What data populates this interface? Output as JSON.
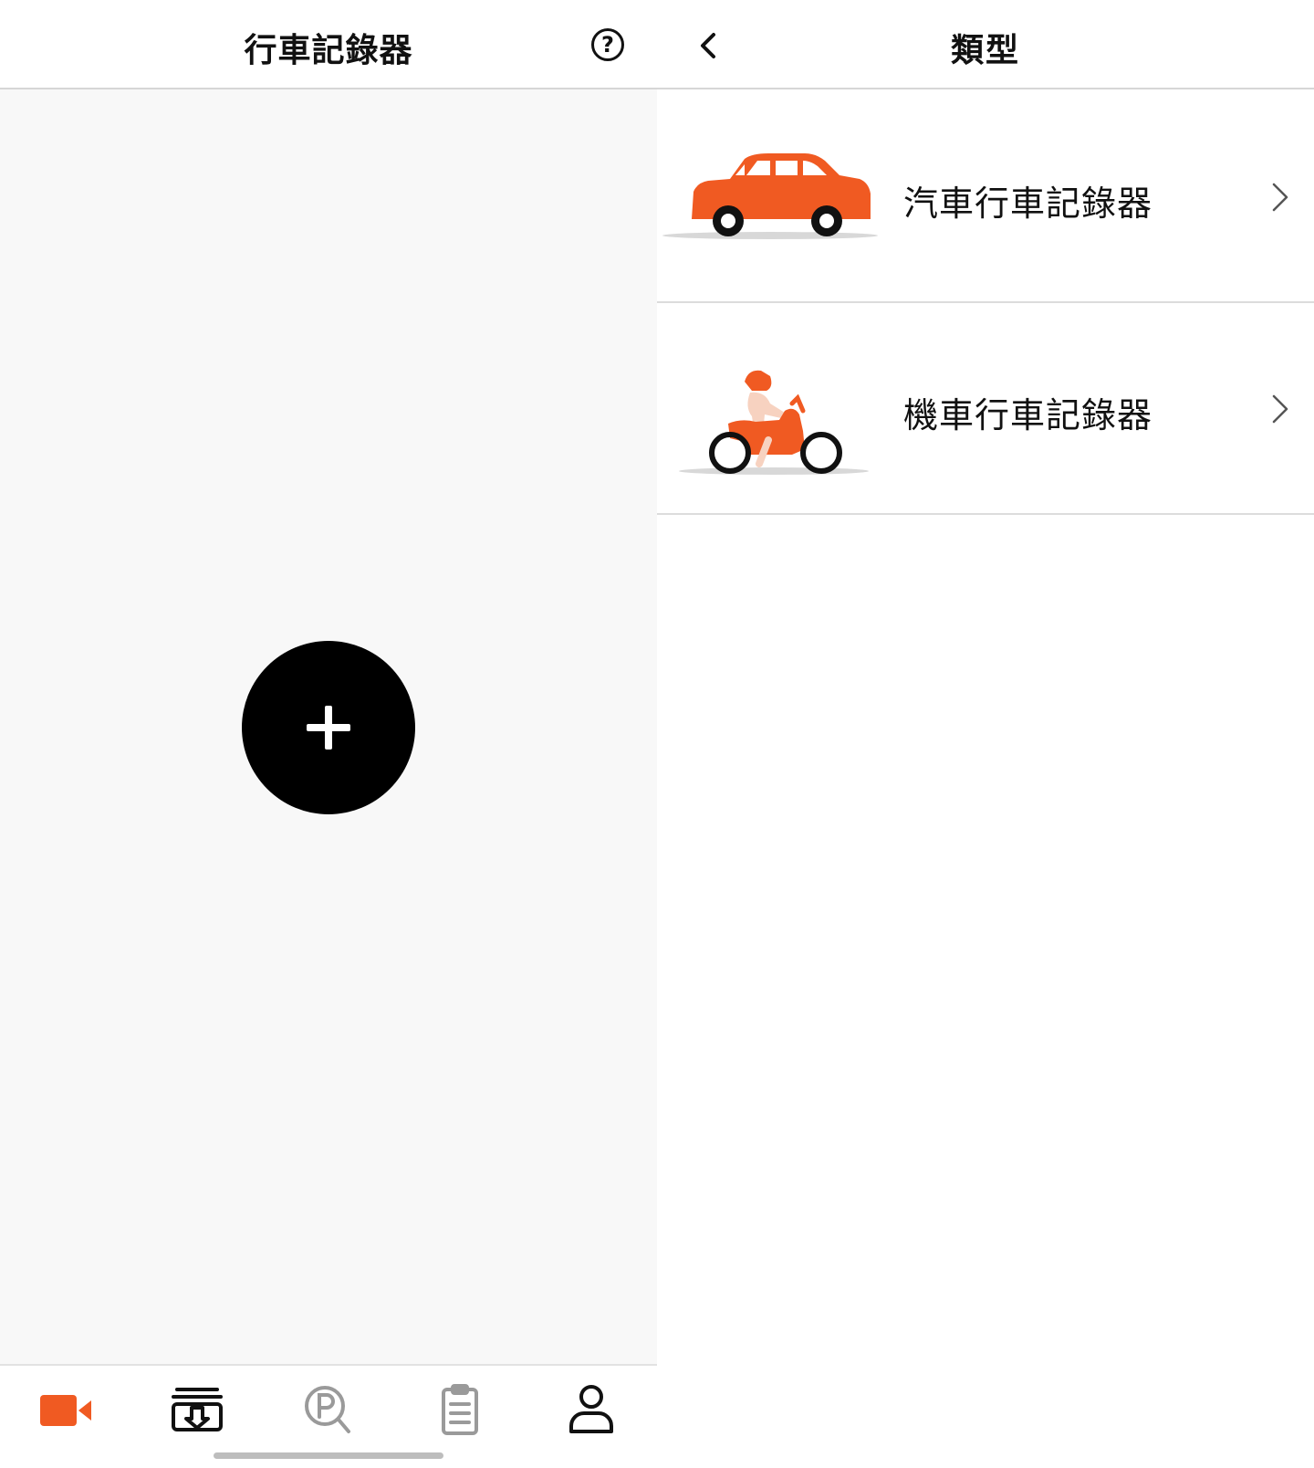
{
  "left_panel": {
    "header": {
      "title": "行車記錄器",
      "help_icon": "?"
    },
    "add_button_icon": "plus-icon",
    "tabbar": {
      "tabs": [
        {
          "icon": "video-camera-icon",
          "active": true
        },
        {
          "icon": "download-box-icon",
          "active": false
        },
        {
          "icon": "parking-search-icon",
          "active": false
        },
        {
          "icon": "clipboard-icon",
          "active": false
        },
        {
          "icon": "user-icon",
          "active": false
        }
      ]
    }
  },
  "right_panel": {
    "header": {
      "title": "類型",
      "back_icon": "chevron-left-icon"
    },
    "options": [
      {
        "label": "汽車行車記錄器",
        "icon": "car-icon"
      },
      {
        "label": "機車行車記錄器",
        "icon": "motorcycle-icon"
      }
    ]
  },
  "colors": {
    "accent": "#f05a22",
    "text": "#111111",
    "inactive_icon": "#9a9a9a"
  }
}
